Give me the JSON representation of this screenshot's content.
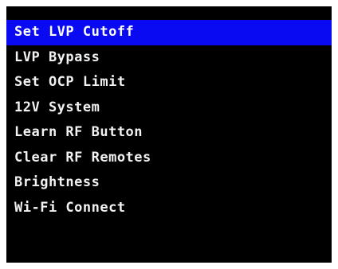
{
  "menu": {
    "selected_index": 0,
    "items": [
      {
        "label": "Set LVP Cutoff"
      },
      {
        "label": "LVP Bypass"
      },
      {
        "label": "Set OCP Limit"
      },
      {
        "label": "12V System"
      },
      {
        "label": "Learn RF Button"
      },
      {
        "label": "Clear RF Remotes"
      },
      {
        "label": "Brightness"
      },
      {
        "label": "Wi-Fi Connect"
      }
    ]
  },
  "colors": {
    "screen_background": "#000000",
    "selection_highlight": "#0a0af2",
    "text": "#f2f2f2"
  }
}
